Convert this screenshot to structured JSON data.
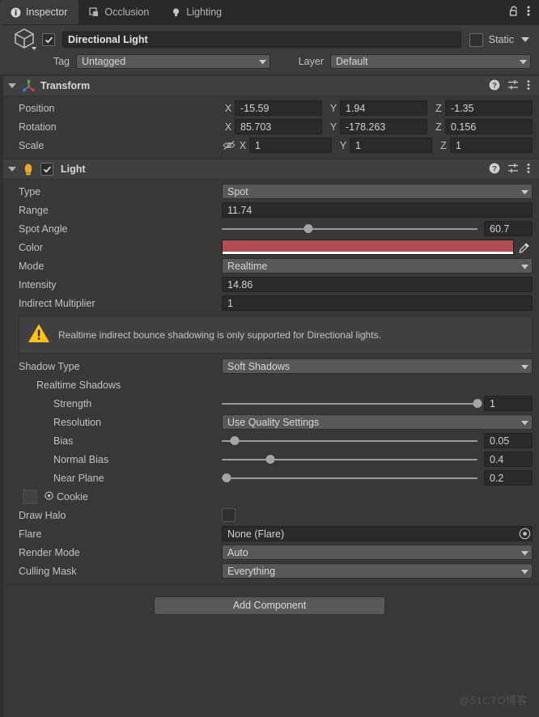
{
  "window": {
    "tabs": [
      {
        "label": "Inspector",
        "icon": "info-icon",
        "active": true
      },
      {
        "label": "Occlusion",
        "icon": "occlusion-icon",
        "active": false
      },
      {
        "label": "Lighting",
        "icon": "lightbulb-icon",
        "active": false
      }
    ],
    "lock_icon": "padlock-open-icon",
    "menu_icon": "kebab-menu-icon"
  },
  "object_header": {
    "prefab_icon": "cube-icon",
    "enabled": true,
    "name": "Directional Light",
    "static_checked": false,
    "static_label": "Static",
    "static_dropdown_icon": "chevron-down-icon",
    "tag_label": "Tag",
    "tag_value": "Untagged",
    "layer_label": "Layer",
    "layer_value": "Default"
  },
  "transform": {
    "title": "Transform",
    "icon": "transform-axis-icon",
    "expanded": true,
    "actions": [
      "help-icon",
      "preset-icon",
      "kebab-menu-icon"
    ],
    "rows": [
      {
        "label": "Position",
        "x": "-15.59",
        "y": "1.94",
        "z": "-1.35",
        "has_eye": false
      },
      {
        "label": "Rotation",
        "x": "85.703",
        "y": "-178.263",
        "z": "0.156",
        "has_eye": false
      },
      {
        "label": "Scale",
        "x": "1",
        "y": "1",
        "z": "1",
        "has_eye": true
      }
    ],
    "axis_labels": {
      "x": "X",
      "y": "Y",
      "z": "Z"
    }
  },
  "light": {
    "title": "Light",
    "icon": "lightbulb-icon",
    "enabled": true,
    "expanded": true,
    "actions": [
      "help-icon",
      "preset-icon",
      "kebab-menu-icon"
    ],
    "type": {
      "label": "Type",
      "value": "Spot"
    },
    "range": {
      "label": "Range",
      "value": "11.74"
    },
    "spot_angle": {
      "label": "Spot Angle",
      "value": "60.7",
      "slider_pct": 34
    },
    "color": {
      "label": "Color",
      "value": "#B04D55",
      "alpha": "#FFFFFF",
      "picker_icon": "eyedropper-icon"
    },
    "mode": {
      "label": "Mode",
      "value": "Realtime"
    },
    "intensity": {
      "label": "Intensity",
      "value": "14.86"
    },
    "indirect_multiplier": {
      "label": "Indirect Multiplier",
      "value": "1"
    },
    "warning": {
      "icon": "warning-triangle-icon",
      "text": "Realtime indirect bounce shadowing is only supported for Directional lights."
    },
    "shadow_type": {
      "label": "Shadow Type",
      "value": "Soft Shadows"
    },
    "realtime_shadows_label": "Realtime Shadows",
    "strength": {
      "label": "Strength",
      "value": "1",
      "slider_pct": 100
    },
    "resolution": {
      "label": "Resolution",
      "value": "Use Quality Settings"
    },
    "bias": {
      "label": "Bias",
      "value": "0.05",
      "slider_pct": 5
    },
    "normal_bias": {
      "label": "Normal Bias",
      "value": "0.4",
      "slider_pct": 19
    },
    "near_plane": {
      "label": "Near Plane",
      "value": "0.2",
      "slider_pct": 2
    },
    "cookie": {
      "label": "Cookie",
      "icon": "object-picker-icon",
      "thumbnail": "empty-texture-thumb"
    },
    "draw_halo": {
      "label": "Draw Halo",
      "checked": false
    },
    "flare": {
      "label": "Flare",
      "value": "None (Flare)",
      "picker_icon": "object-picker-icon"
    },
    "render_mode": {
      "label": "Render Mode",
      "value": "Auto"
    },
    "culling_mask": {
      "label": "Culling Mask",
      "value": "Everything"
    }
  },
  "footer": {
    "add_component_label": "Add Component",
    "watermark": "@51CTO博客"
  },
  "colors": {
    "panel_bg": "#383838",
    "header_bg": "#3c3c3c",
    "tabbar_bg": "#292929",
    "field_bg": "#2a2a2a",
    "dropdown_bg": "#585858",
    "accent_warning": "#FFC107",
    "light_icon": "#F5A623"
  }
}
